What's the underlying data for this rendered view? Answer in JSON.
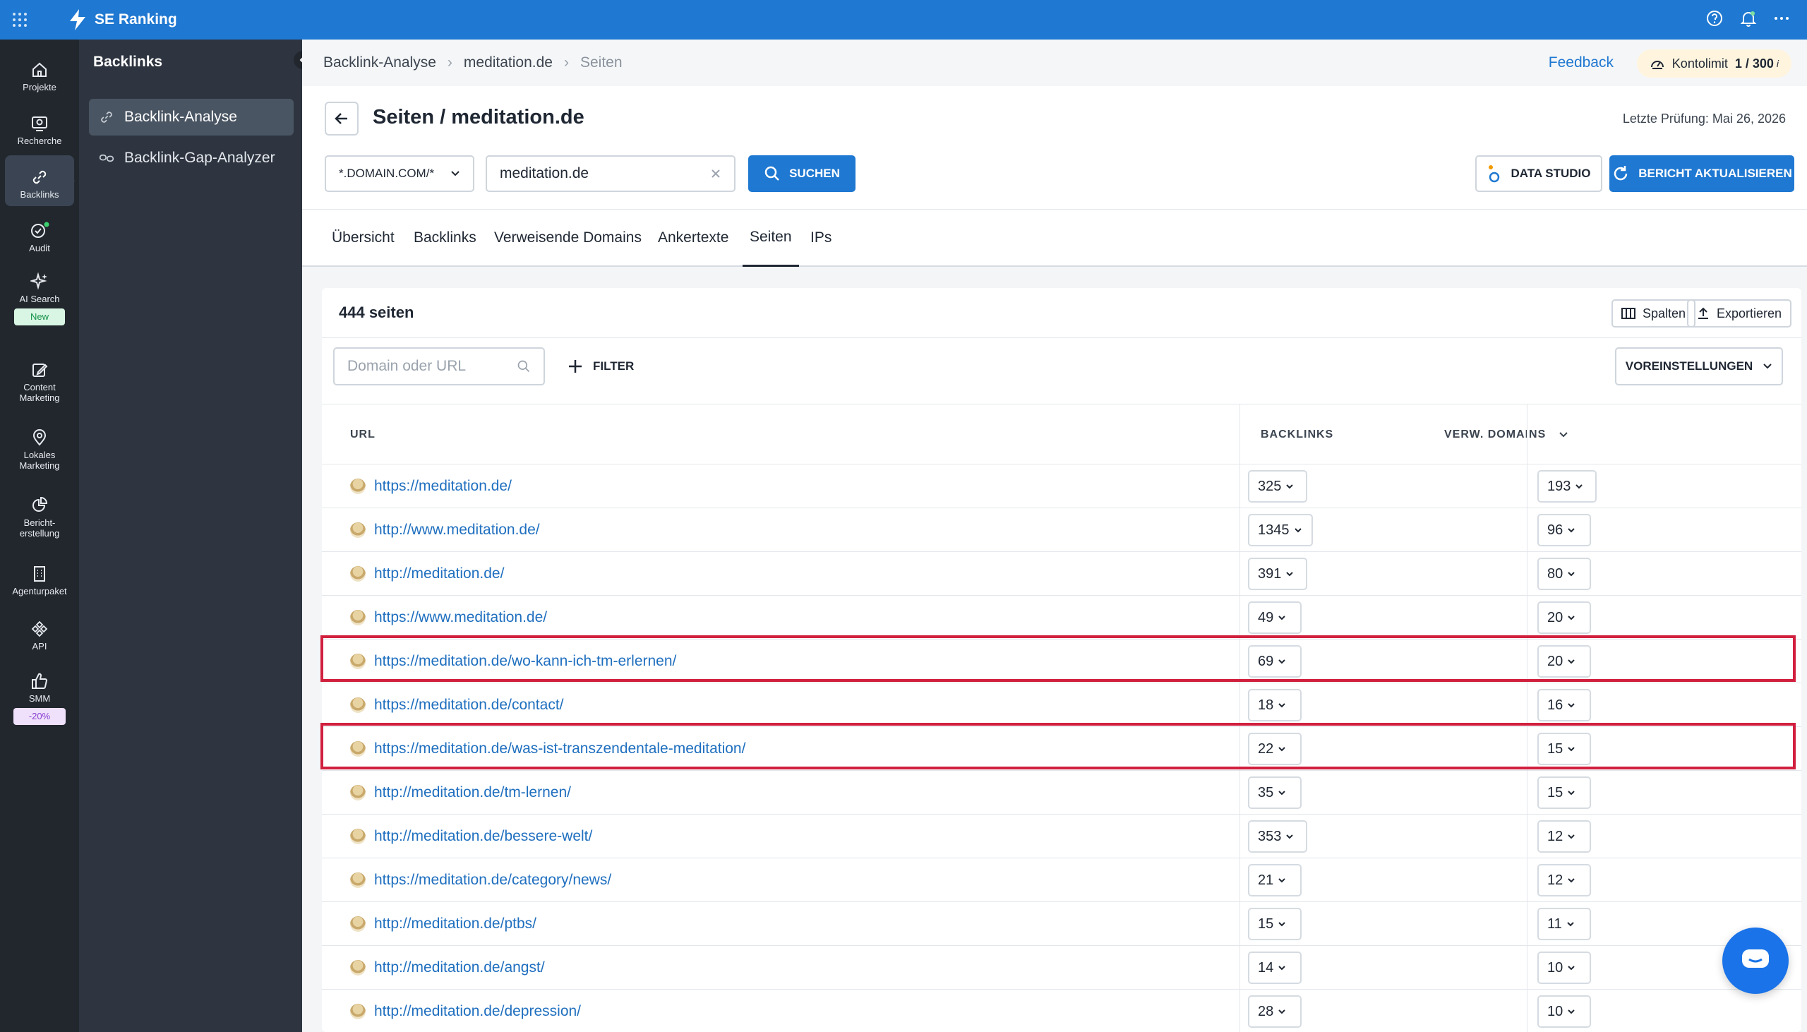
{
  "app": {
    "name": "SE Ranking"
  },
  "rail": [
    {
      "label": "Projekte",
      "icon": "home-icon"
    },
    {
      "label": "Recherche",
      "icon": "research-icon"
    },
    {
      "label": "Backlinks",
      "icon": "link-icon",
      "active": true
    },
    {
      "label": "Audit",
      "icon": "audit-icon"
    },
    {
      "label": "AI Search",
      "icon": "sparkle-icon",
      "badge": "New"
    },
    {
      "label": "Content Marketing",
      "icon": "edit-icon"
    },
    {
      "label": "Lokales Marketing",
      "icon": "location-icon"
    },
    {
      "label": "Bericht-erstellung",
      "icon": "report-icon"
    },
    {
      "label": "Agenturpaket",
      "icon": "building-icon"
    },
    {
      "label": "API",
      "icon": "api-icon"
    },
    {
      "label": "SMM",
      "icon": "thumbs-up-icon",
      "badge": "-20%"
    }
  ],
  "sidebar": {
    "title": "Backlinks",
    "items": [
      {
        "label": "Backlink-Analyse",
        "active": true
      },
      {
        "label": "Backlink-Gap-Analyzer"
      }
    ]
  },
  "breadcrumb": [
    "Backlink-Analyse",
    "meditation.de",
    "Seiten"
  ],
  "header": {
    "feedback": "Feedback",
    "limit_label": "Kontolimit",
    "limit_value": "1 / 300",
    "limit_info": "i"
  },
  "page": {
    "title": "Seiten / meditation.de",
    "last_check": "Letzte Prüfung: Mai 26, 2026",
    "domain_mode": "*.DOMAIN.COM/*",
    "search_value": "meditation.de",
    "search_button": "SUCHEN",
    "data_studio_button": "DATA STUDIO",
    "refresh_button": "BERICHT AKTUALISIEREN"
  },
  "tabs": [
    {
      "label": "Übersicht"
    },
    {
      "label": "Backlinks"
    },
    {
      "label": "Verweisende Domains"
    },
    {
      "label": "Ankertexte"
    },
    {
      "label": "Seiten",
      "active": true
    },
    {
      "label": "IPs"
    }
  ],
  "table": {
    "count_title": "444 seiten",
    "columns_button": "Spalten",
    "export_button": "Exportieren",
    "filter_placeholder": "Domain oder URL",
    "filter_button": "FILTER",
    "presets_button": "VOREINSTELLUNGEN",
    "headers": {
      "url": "URL",
      "backlinks": "BACKLINKS",
      "domains": "VERW. DOMAINS"
    },
    "rows": [
      {
        "url": "https://meditation.de/",
        "backlinks": "325",
        "domains": "193"
      },
      {
        "url": "http://www.meditation.de/",
        "backlinks": "1345",
        "domains": "96"
      },
      {
        "url": "http://meditation.de/",
        "backlinks": "391",
        "domains": "80"
      },
      {
        "url": "https://www.meditation.de/",
        "backlinks": "49",
        "domains": "20"
      },
      {
        "url": "https://meditation.de/wo-kann-ich-tm-erlernen/",
        "backlinks": "69",
        "domains": "20",
        "highlighted": true
      },
      {
        "url": "https://meditation.de/contact/",
        "backlinks": "18",
        "domains": "16"
      },
      {
        "url": "https://meditation.de/was-ist-transzendentale-meditation/",
        "backlinks": "22",
        "domains": "15",
        "highlighted": true
      },
      {
        "url": "http://meditation.de/tm-lernen/",
        "backlinks": "35",
        "domains": "15"
      },
      {
        "url": "http://meditation.de/bessere-welt/",
        "backlinks": "353",
        "domains": "12"
      },
      {
        "url": "https://meditation.de/category/news/",
        "backlinks": "21",
        "domains": "12"
      },
      {
        "url": "http://meditation.de/ptbs/",
        "backlinks": "15",
        "domains": "11"
      },
      {
        "url": "http://meditation.de/angst/",
        "backlinks": "14",
        "domains": "10"
      },
      {
        "url": "http://meditation.de/depression/",
        "backlinks": "28",
        "domains": "10"
      }
    ]
  },
  "colors": {
    "brand": "#1f78d1",
    "rail": "#22272e",
    "sidebar": "#2e3540",
    "highlight": "#d11f3e",
    "link": "#1f6fbf"
  }
}
